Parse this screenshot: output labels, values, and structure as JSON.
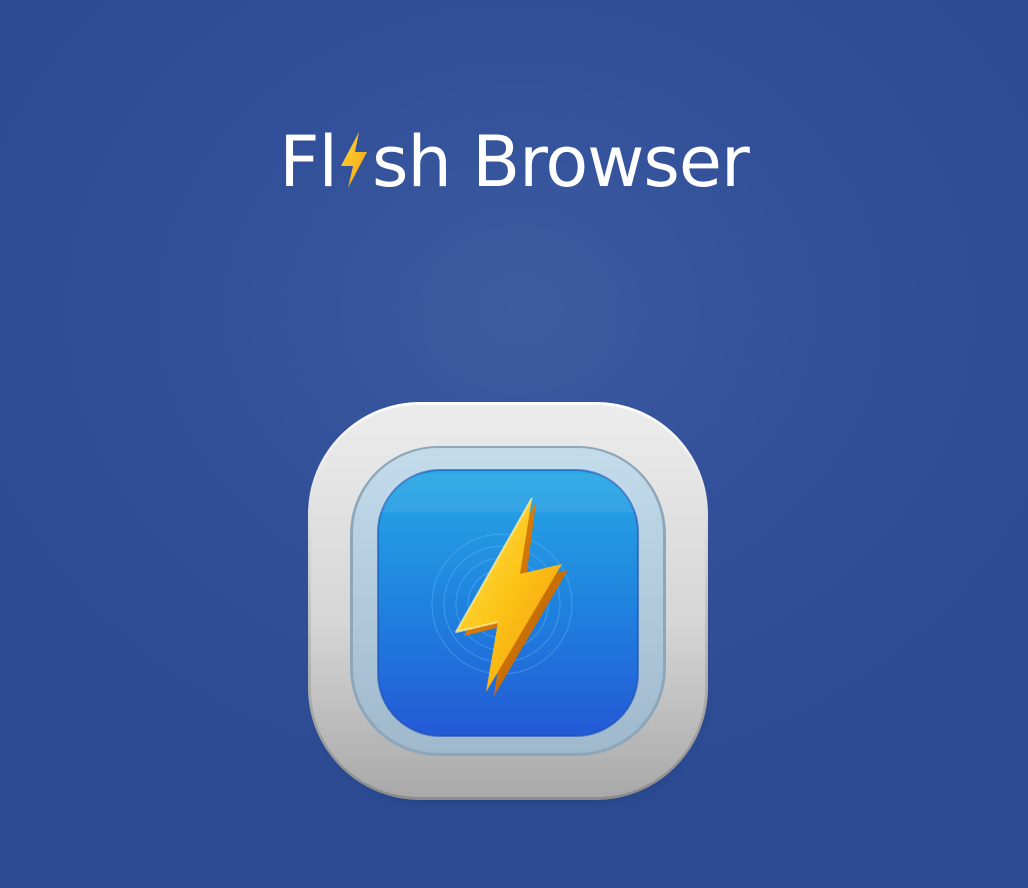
{
  "title": {
    "prefix": "Fl",
    "suffix": "sh Browser",
    "letter_icon": "lightning-bolt-icon"
  },
  "app_icon": {
    "icon": "lightning-bolt-icon"
  },
  "colors": {
    "background": "#33519a",
    "title_text": "#ffffff",
    "bolt_yellow": "#f9c80e",
    "bolt_orange": "#f08a0c",
    "icon_blue": "#1f7fe0",
    "frame_gray": "#d9d9d9"
  }
}
